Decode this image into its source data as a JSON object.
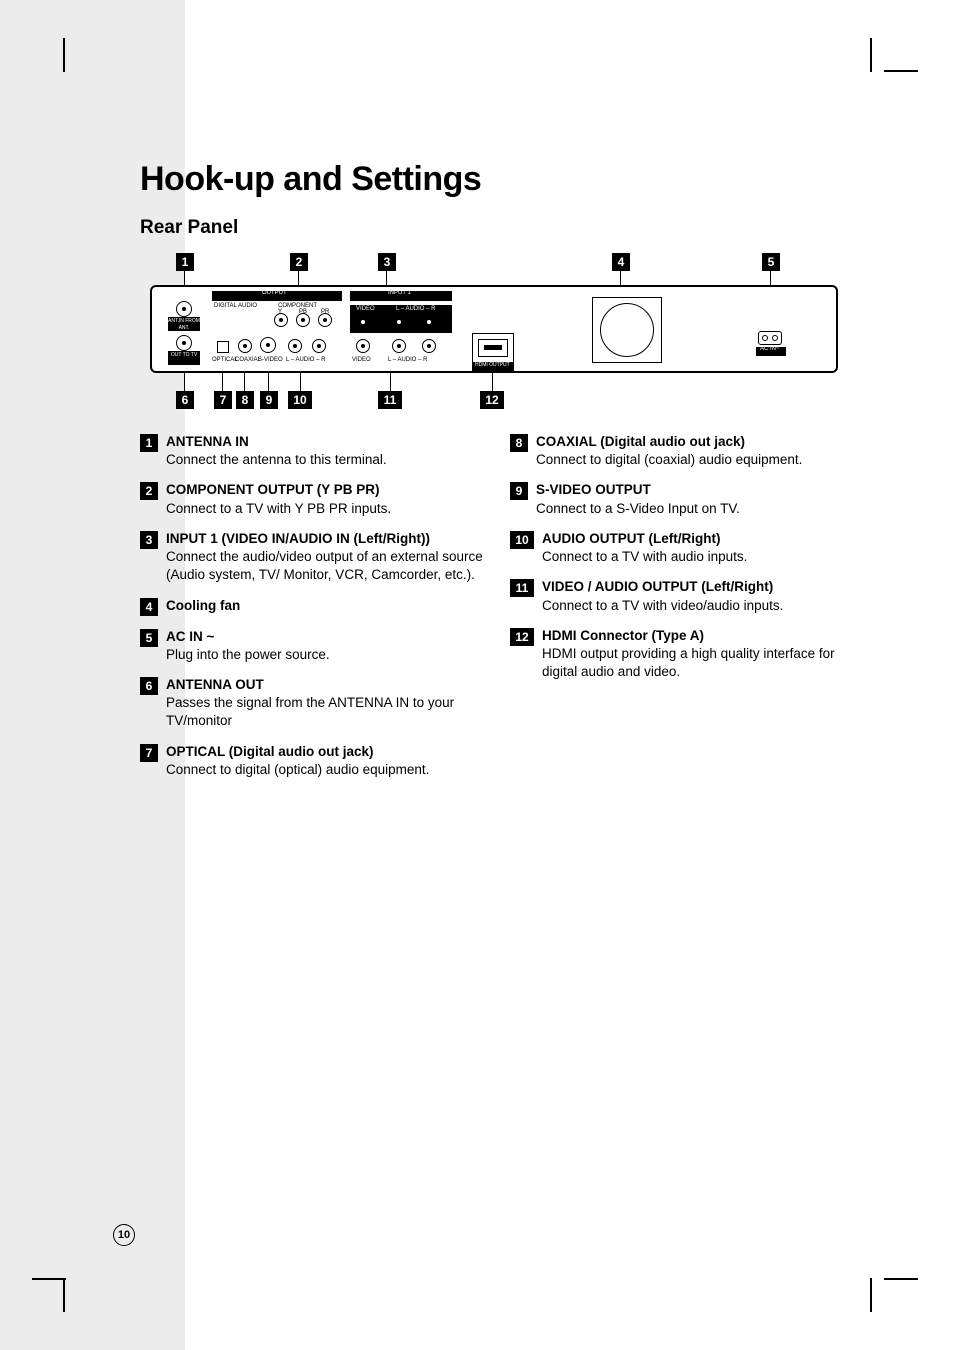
{
  "page": {
    "title": "Hook-up and Settings",
    "subtitle": "Rear Panel",
    "page_number": "10"
  },
  "diagram": {
    "top_callouts": [
      "1",
      "2",
      "3",
      "4",
      "5"
    ],
    "bottom_callouts": [
      "6",
      "7",
      "8",
      "9",
      "10",
      "11",
      "12"
    ],
    "labels": {
      "output_header": "OUTPUT",
      "input1_header": "INPUT 1",
      "digital_audio": "DIGITAL AUDIO",
      "component": "COMPONENT",
      "y": "Y",
      "pb": "PB",
      "pr": "PR",
      "video": "VIDEO",
      "audio_lr": "L – AUDIO – R",
      "optical": "OPTICAL",
      "coaxial": "COAXIAL",
      "svideo": "S-VIDEO",
      "hdmi_output": "HDMI OUTPUT",
      "acin": "AC IN~",
      "ant_in": "ANT.IN FROM ANT.",
      "ant_out": "OUT TO TV"
    }
  },
  "items_left": [
    {
      "n": "1",
      "title": "ANTENNA IN",
      "desc": "Connect the antenna to this terminal."
    },
    {
      "n": "2",
      "title": "COMPONENT OUTPUT (Y PB PR)",
      "desc": "Connect to a TV with Y PB PR inputs."
    },
    {
      "n": "3",
      "title": "INPUT 1 (VIDEO IN/AUDIO IN (Left/Right))",
      "desc": "Connect the audio/video output of an external source (Audio system, TV/ Monitor, VCR, Camcorder, etc.)."
    },
    {
      "n": "4",
      "title": "Cooling fan",
      "desc": ""
    },
    {
      "n": "5",
      "title": "AC IN ~",
      "desc": "Plug into the power source."
    },
    {
      "n": "6",
      "title": "ANTENNA OUT",
      "desc": "Passes the signal from the ANTENNA IN to your TV/monitor"
    },
    {
      "n": "7",
      "title": "OPTICAL (Digital audio out jack)",
      "desc": "Connect to digital (optical) audio equipment."
    }
  ],
  "items_right": [
    {
      "n": "8",
      "title": "COAXIAL (Digital audio out jack)",
      "desc": "Connect to digital (coaxial) audio equipment."
    },
    {
      "n": "9",
      "title": "S-VIDEO OUTPUT",
      "desc": "Connect to a S-Video Input on TV."
    },
    {
      "n": "10",
      "title": "AUDIO OUTPUT (Left/Right)",
      "desc": "Connect to a TV with audio inputs."
    },
    {
      "n": "11",
      "title": "VIDEO / AUDIO OUTPUT (Left/Right)",
      "desc": "Connect to a TV with video/audio inputs."
    },
    {
      "n": "12",
      "title": "HDMI Connector (Type A)",
      "desc": "HDMI output providing a high quality interface for digital audio and video."
    }
  ]
}
